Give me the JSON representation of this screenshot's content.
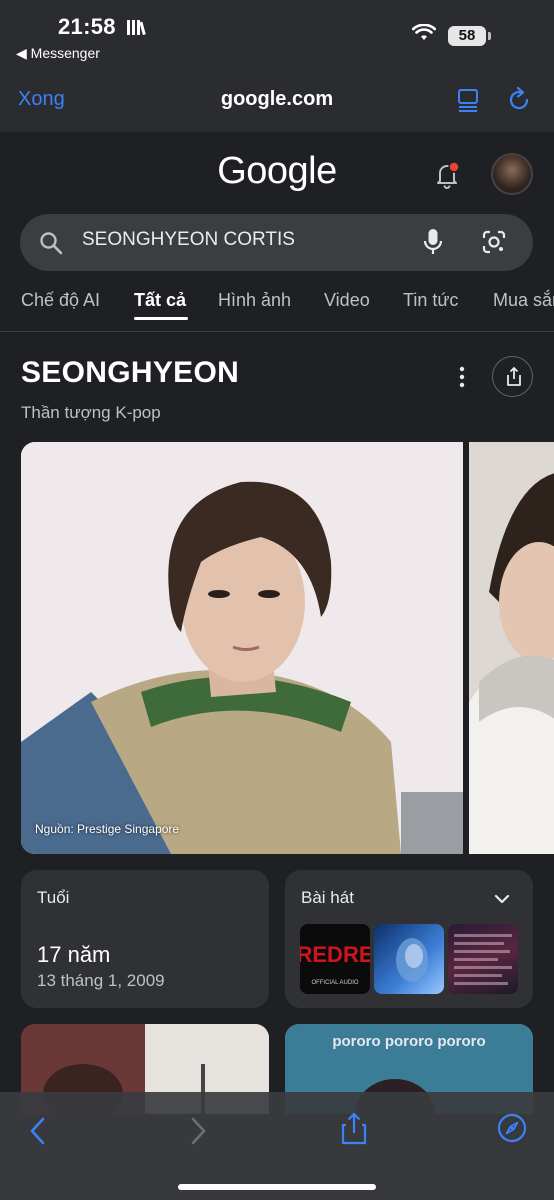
{
  "status_bar": {
    "time": "21:58",
    "back_app": "◀ Messenger",
    "battery": "58"
  },
  "browser": {
    "done_label": "Xong",
    "url": "google.com"
  },
  "google": {
    "logo": "Google"
  },
  "search": {
    "query": "SEONGHYEON CORTIS"
  },
  "tabs": [
    {
      "label": "Chế độ AI"
    },
    {
      "label": "Tất cả"
    },
    {
      "label": "Hình ảnh"
    },
    {
      "label": "Video"
    },
    {
      "label": "Tin tức"
    },
    {
      "label": "Mua sắm"
    }
  ],
  "entity": {
    "title": "SEONGHYEON",
    "subtitle": "Thần tượng K-pop",
    "image_source": "Nguồn: Prestige Singapore"
  },
  "cards": {
    "age": {
      "label": "Tuổi",
      "value": "17 năm",
      "birth_date": "13 tháng 1, 2009"
    },
    "songs": {
      "label": "Bài hát"
    }
  },
  "song_thumbs": {
    "song1_text": "REDRE",
    "song1_sub": "OFFICIAL AUDIO",
    "song2_text": "",
    "song3_text": ""
  },
  "bottom_cards": {
    "card2_text": "pororo pororo pororo"
  },
  "colors": {
    "accent": "#3b82f6",
    "bg": "#1f2023",
    "card": "#303134",
    "notification_dot": "#ea4335"
  }
}
